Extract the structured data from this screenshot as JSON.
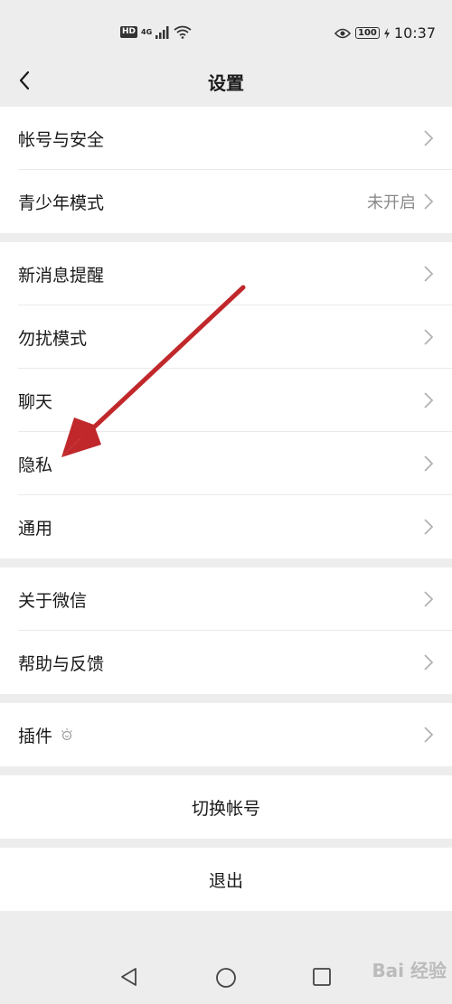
{
  "status_bar": {
    "hd": "HD",
    "network": "4G",
    "battery": "100",
    "time": "10:37"
  },
  "nav": {
    "title": "设置"
  },
  "groups": [
    {
      "rows": [
        {
          "label": "帐号与安全",
          "value": ""
        },
        {
          "label": "青少年模式",
          "value": "未开启"
        }
      ]
    },
    {
      "rows": [
        {
          "label": "新消息提醒"
        },
        {
          "label": "勿扰模式"
        },
        {
          "label": "聊天"
        },
        {
          "label": "隐私"
        },
        {
          "label": "通用"
        }
      ]
    },
    {
      "rows": [
        {
          "label": "关于微信"
        },
        {
          "label": "帮助与反馈"
        }
      ]
    },
    {
      "rows": [
        {
          "label": "插件"
        }
      ]
    }
  ],
  "buttons": {
    "switch_account": "切换帐号",
    "logout": "退出"
  },
  "watermark": "Bai 经验",
  "colors": {
    "background": "#ededed",
    "arrow": "#c0282b"
  }
}
